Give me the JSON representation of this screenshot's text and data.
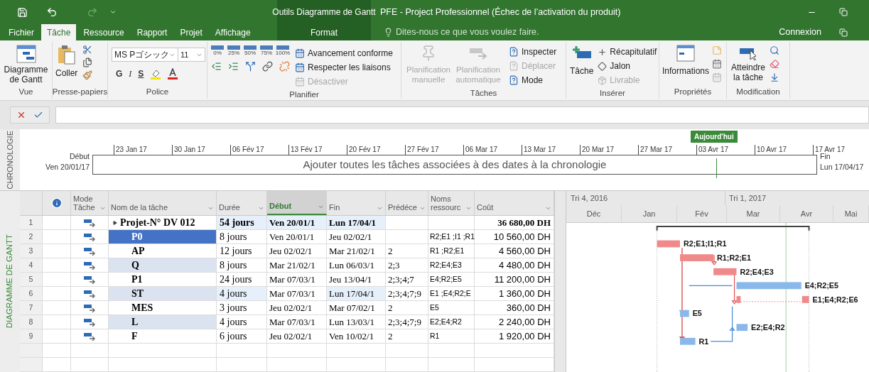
{
  "title_bar": {
    "context_group": "Outils Diagramme de Gantt",
    "title": "PFE - Project Professionnel (Échec de l’activation du produit)"
  },
  "tabs": [
    {
      "label": "Fichier",
      "selected": false,
      "contextual": false
    },
    {
      "label": "Tâche",
      "selected": true,
      "contextual": false
    },
    {
      "label": "Ressource",
      "selected": false,
      "contextual": false
    },
    {
      "label": "Rapport",
      "selected": false,
      "contextual": false
    },
    {
      "label": "Projet",
      "selected": false,
      "contextual": false
    },
    {
      "label": "Affichage",
      "selected": false,
      "contextual": false
    },
    {
      "label": "Format",
      "selected": false,
      "contextual": true
    }
  ],
  "tell_me": {
    "placeholder": "Dites-nous ce que vous voulez faire."
  },
  "account": "Connexion",
  "ribbon": {
    "vue": {
      "label": "Vue",
      "button": "Diagramme de Gantt"
    },
    "clipboard": {
      "label": "Presse-papiers",
      "paste": "Coller"
    },
    "font": {
      "label": "Police",
      "family": "MS Pゴシック",
      "size": "11",
      "bold": "G",
      "italic": "I",
      "underline": "S"
    },
    "schedule": {
      "label": "Planifier",
      "percents": [
        "0%",
        "25%",
        "50%",
        "75%",
        "100%"
      ],
      "commands": [
        {
          "label": "Avancement conforme",
          "disabled": false
        },
        {
          "label": "Respecter les liaisons",
          "disabled": false
        },
        {
          "label": "Désactiver",
          "disabled": true
        }
      ]
    },
    "tasks": {
      "label": "Tâches",
      "buttons": [
        {
          "label": "Planification manuelle",
          "disabled": true
        },
        {
          "label": "Planification automatique",
          "disabled": true
        }
      ],
      "commands": [
        {
          "label": "Inspecter",
          "disabled": false
        },
        {
          "label": "Déplacer",
          "disabled": true
        },
        {
          "label": "Mode",
          "disabled": false
        }
      ]
    },
    "insert": {
      "label": "Insérer",
      "task": "Tâche",
      "commands": [
        {
          "label": "Récapitulatif",
          "disabled": false
        },
        {
          "label": "Jalon",
          "disabled": false
        },
        {
          "label": "Livrable",
          "disabled": true
        }
      ]
    },
    "properties": {
      "label": "Propriétés",
      "info": "Informations"
    },
    "editing": {
      "label": "Modification",
      "goto": "Atteindre la tâche"
    }
  },
  "timeline": {
    "label": "CHRONOLOGIE",
    "ticks": [
      "23 Jan 17",
      "30 Jan 17",
      "06 Fév 17",
      "13 Fév 17",
      "20 Fév 17",
      "27 Fév 17",
      "06 Mar 17",
      "13 Mar 17",
      "20 Mar 17",
      "27 Mar 17",
      "03 Avr 17",
      "10 Avr 17",
      "17 Avr 17"
    ],
    "start_label": "Début",
    "start_date": "Ven 20/01/17",
    "finish_label": "Fin",
    "finish_date": "Lun 17/04/17",
    "hint": "Ajouter toutes les tâches associées à des dates à la chronologie",
    "today": "Aujourd'hui"
  },
  "view_label": "DIAGRAMME DE GANTT",
  "table": {
    "columns": [
      {
        "label": "Mode Tâche",
        "selected": false
      },
      {
        "label": "Nom de la tâche",
        "selected": false
      },
      {
        "label": "Durée",
        "selected": false
      },
      {
        "label": "Début",
        "selected": true
      },
      {
        "label": "Fin",
        "selected": false
      },
      {
        "label": "Prédéce",
        "selected": false
      },
      {
        "label": "Noms ressourc",
        "selected": false
      },
      {
        "label": "Coût",
        "selected": false
      }
    ],
    "rows": [
      {
        "id": "1",
        "name": "Projet-N° DV 012",
        "summary": true,
        "selected": false,
        "shaded": false,
        "duration": "54 jours",
        "start": "Ven 20/01/1",
        "finish": "Lun 17/04/1",
        "cost": "36 680,00 DH",
        "duration_changed": true,
        "start_changed": true,
        "finish_changed": true
      },
      {
        "id": "2",
        "name": "P0",
        "summary": false,
        "selected": true,
        "shaded": false,
        "duration": "8 jours",
        "start": "Ven 20/01/1",
        "finish": "Jeu 02/02/1",
        "resources": "R2;E1 ;I1 ;R1",
        "cost": "10 560,00 DH",
        "duration_changed": false,
        "start_changed": false,
        "finish_changed": false
      },
      {
        "id": "3",
        "name": "AP",
        "summary": false,
        "selected": false,
        "shaded": false,
        "duration": "12 jours",
        "start": "Jeu 02/02/1",
        "finish": "Mar 21/02/1",
        "predecessors": "2",
        "resources": "R1 ;R2;E1",
        "cost": "4 560,00 DH",
        "duration_changed": false,
        "start_changed": false,
        "finish_changed": false
      },
      {
        "id": "4",
        "name": "Q",
        "summary": false,
        "selected": false,
        "shaded": true,
        "duration": "8 jours",
        "start": "Mar 21/02/1",
        "finish": "Lun 06/03/1",
        "predecessors": "2;3",
        "resources": "R2;E4;E3",
        "cost": "4 480,00 DH",
        "duration_changed": false,
        "start_changed": false,
        "finish_changed": false
      },
      {
        "id": "5",
        "name": "P1",
        "summary": false,
        "selected": false,
        "shaded": false,
        "duration": "24 jours",
        "start": "Mar 07/03/1",
        "finish": "Jeu 13/04/1",
        "predecessors": "2;3;4;7",
        "resources": "E4;R2;E5",
        "cost": "11 200,00 DH",
        "duration_changed": false,
        "start_changed": false,
        "finish_changed": false
      },
      {
        "id": "6",
        "name": "ST",
        "summary": false,
        "selected": false,
        "shaded": true,
        "duration": "4 jours",
        "start": "Mar 07/03/1",
        "finish": "Lun 17/04/1",
        "predecessors": "2;3;4;7;9",
        "resources": "E1 ;E4;R2;E",
        "cost": "1 360,00 DH",
        "duration_changed": true,
        "start_changed": false,
        "finish_changed": true
      },
      {
        "id": "7",
        "name": "MES",
        "summary": false,
        "selected": false,
        "shaded": false,
        "duration": "3 jours",
        "start": "Jeu 02/02/1",
        "finish": "Mar 07/02/1",
        "predecessors": "2",
        "resources": "E5",
        "cost": "360,00 DH",
        "duration_changed": false,
        "start_changed": false,
        "finish_changed": false
      },
      {
        "id": "8",
        "name": "L",
        "summary": false,
        "selected": false,
        "shaded": true,
        "duration": "4 jours",
        "start": "Mar 07/03/1",
        "finish": "Lun 13/03/1",
        "predecessors": "2;3;4;7;9",
        "resources": "E2;E4;R2",
        "cost": "2 240,00 DH",
        "duration_changed": false,
        "start_changed": false,
        "finish_changed": false
      },
      {
        "id": "9",
        "name": "F",
        "summary": false,
        "selected": false,
        "shaded": false,
        "duration": "6 jours",
        "start": "Jeu 02/02/1",
        "finish": "Ven 10/02/1",
        "predecessors": "2",
        "resources": "R1",
        "cost": "1 920,00 DH",
        "duration_changed": false,
        "start_changed": false,
        "finish_changed": false
      }
    ]
  },
  "gantt": {
    "quarters": [
      "Tri 4, 2016",
      "Tri 1, 2017"
    ],
    "months": [
      "Déc",
      "Jan",
      "Fév",
      "Mar",
      "Avr",
      "Mai"
    ],
    "bars": [
      {
        "label": "R2;E1;I1;R1",
        "critical": true
      },
      {
        "label": "R1;R2;E1",
        "critical": true
      },
      {
        "label": "R2;E4;E3",
        "critical": true
      },
      {
        "label": "E4;R2;E5",
        "critical": false
      },
      {
        "label": "E1;E4;R2;E6",
        "critical": true
      },
      {
        "label": "E5",
        "critical": false
      },
      {
        "label": "E2;E4;R2",
        "critical": false
      },
      {
        "label": "R1",
        "critical": false
      }
    ]
  }
}
